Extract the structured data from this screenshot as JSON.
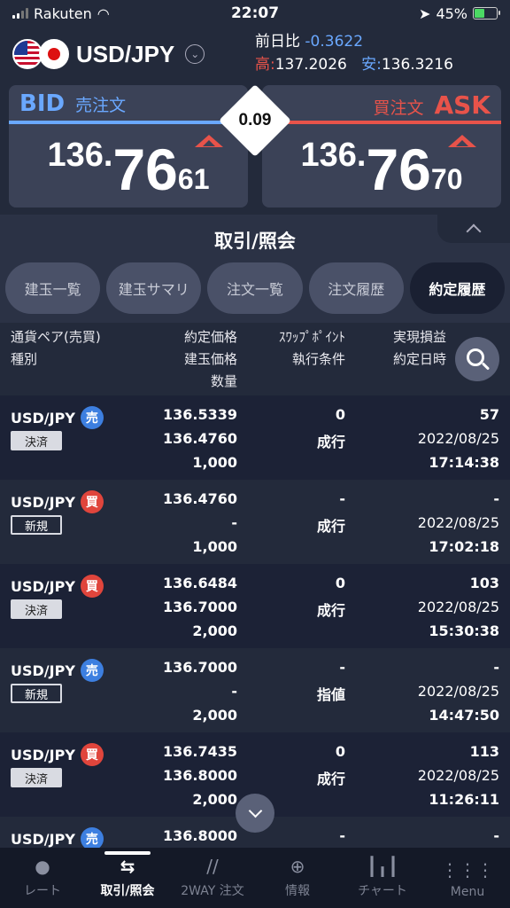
{
  "status": {
    "carrier": "Rakuten",
    "time": "22:07",
    "battery": "45%"
  },
  "header": {
    "pair": "USD/JPY",
    "change_label": "前日比",
    "change_value": "-0.3622",
    "high_label": "高:",
    "high_value": "137.2026",
    "low_label": "安:",
    "low_value": "136.3216"
  },
  "bid": {
    "label": "BID",
    "sub": "売注文",
    "p1": "136.",
    "p2": "76",
    "p3": "61"
  },
  "ask": {
    "label": "ASK",
    "sub": "買注文",
    "p1": "136.",
    "p2": "76",
    "p3": "70"
  },
  "spread": "0.09",
  "section_title": "取引/照会",
  "tabs": [
    "建玉一覧",
    "建玉サマリ",
    "注文一覧",
    "注文履歴",
    "約定履歴"
  ],
  "columns": {
    "c1a": "通貨ペア(売買)",
    "c1b": "種別",
    "c2a": "約定価格",
    "c2b": "建玉価格",
    "c2c": "数量",
    "c3a": "ｽﾜｯﾌﾟﾎﾟｲﾝﾄ",
    "c3b": "執行条件",
    "c4a": "実現損益",
    "c4b": "約定日時"
  },
  "rows": [
    {
      "pair": "USD/JPY",
      "side": "売",
      "type": "決済",
      "price": "136.5339",
      "pos_price": "136.4760",
      "qty": "1,000",
      "swap": "0",
      "cond": "成行",
      "pnl": "57",
      "date": "2022/08/25",
      "time": "17:14:38"
    },
    {
      "pair": "USD/JPY",
      "side": "買",
      "type": "新規",
      "price": "136.4760",
      "pos_price": "-",
      "qty": "1,000",
      "swap": "-",
      "cond": "成行",
      "pnl": "-",
      "date": "2022/08/25",
      "time": "17:02:18"
    },
    {
      "pair": "USD/JPY",
      "side": "買",
      "type": "決済",
      "price": "136.6484",
      "pos_price": "136.7000",
      "qty": "2,000",
      "swap": "0",
      "cond": "成行",
      "pnl": "103",
      "date": "2022/08/25",
      "time": "15:30:38"
    },
    {
      "pair": "USD/JPY",
      "side": "売",
      "type": "新規",
      "price": "136.7000",
      "pos_price": "-",
      "qty": "2,000",
      "swap": "-",
      "cond": "指値",
      "pnl": "-",
      "date": "2022/08/25",
      "time": "14:47:50"
    },
    {
      "pair": "USD/JPY",
      "side": "買",
      "type": "決済",
      "price": "136.7435",
      "pos_price": "136.8000",
      "qty": "2,000",
      "swap": "0",
      "cond": "成行",
      "pnl": "113",
      "date": "2022/08/25",
      "time": "11:26:11"
    },
    {
      "pair": "USD/JPY",
      "side": "売",
      "type": "",
      "price": "136.8000",
      "pos_price": "",
      "qty": "",
      "swap": "-",
      "cond": "",
      "pnl": "-",
      "date": "",
      "time": ""
    }
  ],
  "tabbar": [
    "レート",
    "取引/照会",
    "2WAY 注文",
    "情報",
    "チャート",
    "Menu"
  ],
  "colors": {
    "bid": "#6aa8ff",
    "ask": "#e8534a",
    "bg": "#232a3b"
  }
}
